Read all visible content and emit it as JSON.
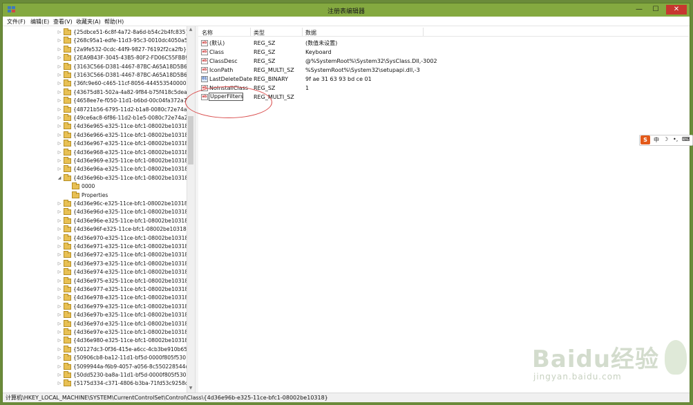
{
  "window": {
    "title": "注册表编辑器",
    "minimize": "—",
    "maximize": "☐",
    "close": "✕"
  },
  "menu": [
    "文件(F)",
    "编辑(E)",
    "查看(V)",
    "收藏夹(A)",
    "帮助(H)"
  ],
  "tree": [
    {
      "label": "{25dbce51-6c8f-4a72-8a6d-b54c2b4fc835}",
      "level": 0,
      "expander": "▷"
    },
    {
      "label": "{268c95a1-edfe-11d3-95c3-0010dc4050a5}",
      "level": 0,
      "expander": "▷"
    },
    {
      "label": "{2a9fe532-0cdc-44f9-9827-76192f2ca2fb}",
      "level": 0,
      "expander": "▷"
    },
    {
      "label": "{2EA9B43F-3045-43B5-80F2-FD06C55FBB90}",
      "level": 0,
      "expander": "▷"
    },
    {
      "label": "{3163C566-D381-4467-87BC-A65A18D5B648}",
      "level": 0,
      "expander": "▷"
    },
    {
      "label": "{3163C566-D381-4467-87BC-A65A18D5B649}",
      "level": 0,
      "expander": "▷"
    },
    {
      "label": "{36fc9e60-c465-11cf-8056-444553540000}",
      "level": 0,
      "expander": "▷"
    },
    {
      "label": "{43675d81-502a-4a82-9f84-b75f418c5dea}",
      "level": 0,
      "expander": "▷"
    },
    {
      "label": "{4658ee7e-f050-11d1-b6bd-00c04fa372a7}",
      "level": 0,
      "expander": "▷"
    },
    {
      "label": "{48721b56-6795-11d2-b1a8-0080c72e74a2}",
      "level": 0,
      "expander": "▷"
    },
    {
      "label": "{49ce6ac8-6f86-11d2-b1e5-0080c72e74a2}",
      "level": 0,
      "expander": "▷"
    },
    {
      "label": "{4d36e965-e325-11ce-bfc1-08002be10318}",
      "level": 0,
      "expander": "▷"
    },
    {
      "label": "{4d36e966-e325-11ce-bfc1-08002be10318}",
      "level": 0,
      "expander": "▷"
    },
    {
      "label": "{4d36e967-e325-11ce-bfc1-08002be10318}",
      "level": 0,
      "expander": "▷"
    },
    {
      "label": "{4d36e968-e325-11ce-bfc1-08002be10318}",
      "level": 0,
      "expander": "▷"
    },
    {
      "label": "{4d36e969-e325-11ce-bfc1-08002be10318}",
      "level": 0,
      "expander": "▷"
    },
    {
      "label": "{4d36e96a-e325-11ce-bfc1-08002be10318}",
      "level": 0,
      "expander": "▷"
    },
    {
      "label": "{4d36e96b-e325-11ce-bfc1-08002be10318}",
      "level": 0,
      "expander": "◢"
    },
    {
      "label": "0000",
      "level": 1,
      "expander": ""
    },
    {
      "label": "Properties",
      "level": 1,
      "expander": ""
    },
    {
      "label": "{4d36e96c-e325-11ce-bfc1-08002be10318}",
      "level": 0,
      "expander": "▷"
    },
    {
      "label": "{4d36e96d-e325-11ce-bfc1-08002be10318}",
      "level": 0,
      "expander": "▷"
    },
    {
      "label": "{4d36e96e-e325-11ce-bfc1-08002be10318}",
      "level": 0,
      "expander": "▷"
    },
    {
      "label": "{4d36e96f-e325-11ce-bfc1-08002be10318}",
      "level": 0,
      "expander": "▷"
    },
    {
      "label": "{4d36e970-e325-11ce-bfc1-08002be10318}",
      "level": 0,
      "expander": "▷"
    },
    {
      "label": "{4d36e971-e325-11ce-bfc1-08002be10318}",
      "level": 0,
      "expander": "▷"
    },
    {
      "label": "{4d36e972-e325-11ce-bfc1-08002be10318}",
      "level": 0,
      "expander": "▷"
    },
    {
      "label": "{4d36e973-e325-11ce-bfc1-08002be10318}",
      "level": 0,
      "expander": "▷"
    },
    {
      "label": "{4d36e974-e325-11ce-bfc1-08002be10318}",
      "level": 0,
      "expander": "▷"
    },
    {
      "label": "{4d36e975-e325-11ce-bfc1-08002be10318}",
      "level": 0,
      "expander": "▷"
    },
    {
      "label": "{4d36e977-e325-11ce-bfc1-08002be10318}",
      "level": 0,
      "expander": "▷"
    },
    {
      "label": "{4d36e978-e325-11ce-bfc1-08002be10318}",
      "level": 0,
      "expander": "▷"
    },
    {
      "label": "{4d36e979-e325-11ce-bfc1-08002be10318}",
      "level": 0,
      "expander": "▷"
    },
    {
      "label": "{4d36e97b-e325-11ce-bfc1-08002be10318}",
      "level": 0,
      "expander": "▷"
    },
    {
      "label": "{4d36e97d-e325-11ce-bfc1-08002be10318}",
      "level": 0,
      "expander": "▷"
    },
    {
      "label": "{4d36e97e-e325-11ce-bfc1-08002be10318}",
      "level": 0,
      "expander": "▷"
    },
    {
      "label": "{4d36e980-e325-11ce-bfc1-08002be10318}",
      "level": 0,
      "expander": "▷"
    },
    {
      "label": "{50127dc3-0f36-415e-a6cc-4cb3be910b65}",
      "level": 0,
      "expander": "▷"
    },
    {
      "label": "{50906cb8-ba12-11d1-bf5d-0000f805f530}",
      "level": 0,
      "expander": "▷"
    },
    {
      "label": "{5099944a-f6b9-4057-a056-8c550228544c}",
      "level": 0,
      "expander": "▷"
    },
    {
      "label": "{50dd5230-ba8a-11d1-bf5d-0000f805f530}",
      "level": 0,
      "expander": "▷"
    },
    {
      "label": "{5175d334-c371-4806-b3ba-71fd53c9258d}",
      "level": 0,
      "expander": "▷"
    }
  ],
  "columns": {
    "name": "名称",
    "type": "类型",
    "data": "数据"
  },
  "values": [
    {
      "name": "(默认)",
      "type": "REG_SZ",
      "data": "(数值未设置)",
      "icon": "string"
    },
    {
      "name": "Class",
      "type": "REG_SZ",
      "data": "Keyboard",
      "icon": "string"
    },
    {
      "name": "ClassDesc",
      "type": "REG_SZ",
      "data": "@%SystemRoot%\\System32\\SysClass.Dll,-3002",
      "icon": "string"
    },
    {
      "name": "IconPath",
      "type": "REG_MULTI_SZ",
      "data": "%SystemRoot%\\System32\\setupapi.dll,-3",
      "icon": "string"
    },
    {
      "name": "LastDeleteDate",
      "type": "REG_BINARY",
      "data": "9f ae 31 63 93 bd ce 01",
      "icon": "binary"
    },
    {
      "name": "NoInstallClass",
      "type": "REG_SZ",
      "data": "1",
      "icon": "string"
    },
    {
      "name": "UpperFilters",
      "type": "REG_MULTI_SZ",
      "data": "",
      "icon": "string",
      "editing": true
    }
  ],
  "status": "计算机\\HKEY_LOCAL_MACHINE\\SYSTEM\\CurrentControlSet\\Control\\Class\\{4d36e96b-e325-11ce-bfc1-08002be10318}",
  "ime": {
    "logo": "S",
    "items": [
      "中",
      "☽",
      "•,",
      "⌨"
    ]
  },
  "watermark": {
    "brand": "Baidu经验",
    "url": "jingyan.baidu.com"
  }
}
